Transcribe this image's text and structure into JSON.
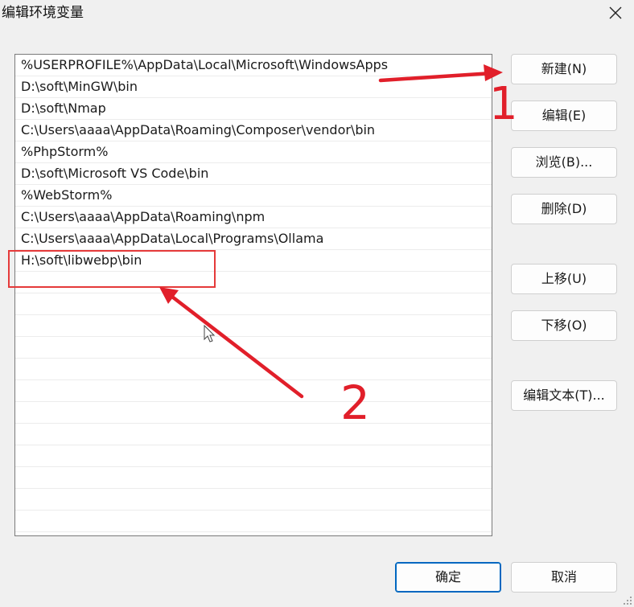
{
  "window": {
    "title": "编辑环境变量"
  },
  "path_list": {
    "items": [
      "%USERPROFILE%\\AppData\\Local\\Microsoft\\WindowsApps",
      "D:\\soft\\MinGW\\bin",
      "D:\\soft\\Nmap",
      "C:\\Users\\aaaa\\AppData\\Roaming\\Composer\\vendor\\bin",
      "%PhpStorm%",
      "D:\\soft\\Microsoft VS Code\\bin",
      "%WebStorm%",
      "C:\\Users\\aaaa\\AppData\\Roaming\\npm",
      "C:\\Users\\aaaa\\AppData\\Local\\Programs\\Ollama",
      "H:\\soft\\libwebp\\bin"
    ]
  },
  "buttons": {
    "new": "新建(N)",
    "edit": "编辑(E)",
    "browse": "浏览(B)...",
    "delete": "删除(D)",
    "move_up": "上移(U)",
    "move_down": "下移(O)",
    "edit_text": "编辑文本(T)...",
    "ok": "确定",
    "cancel": "取消"
  },
  "annotations": {
    "step1": "1",
    "step2": "2",
    "color": "#e11f2a"
  },
  "colors": {
    "dialog_bg": "#f0f0f0",
    "list_bg": "#ffffff",
    "primary_border": "#0067c0"
  }
}
